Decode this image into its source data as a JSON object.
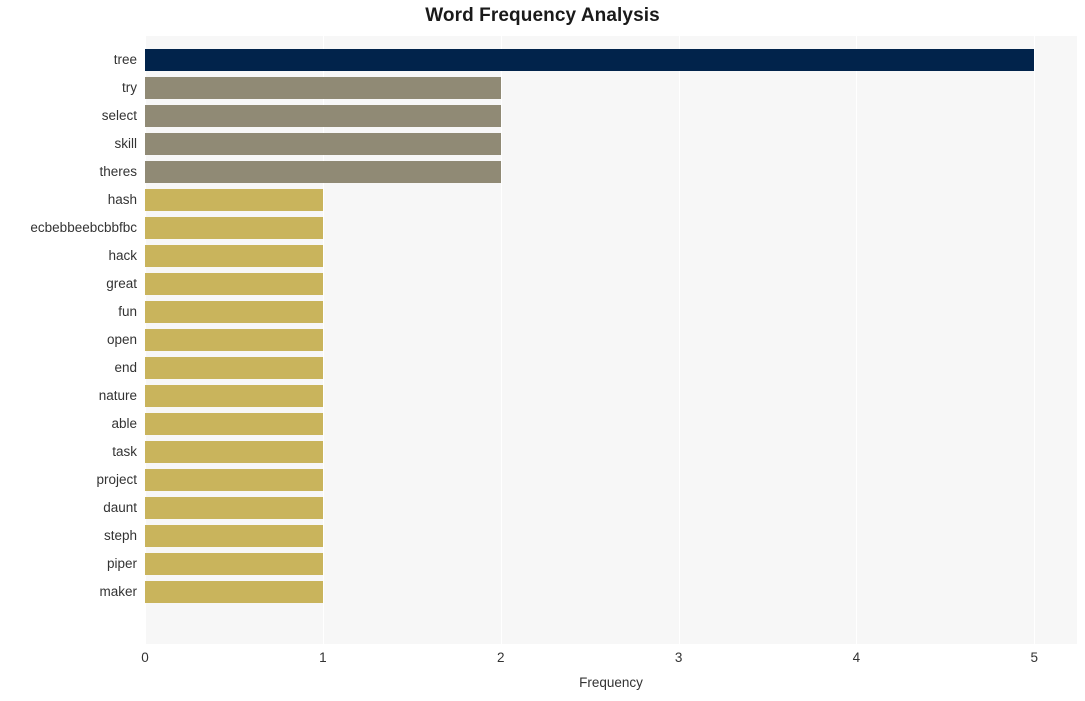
{
  "chart_data": {
    "type": "bar",
    "orientation": "horizontal",
    "title": "Word Frequency Analysis",
    "xlabel": "Frequency",
    "ylabel": "",
    "xlim": [
      0,
      5.24
    ],
    "xticks": [
      0,
      1,
      2,
      3,
      4,
      5
    ],
    "xtick_labels": [
      "0",
      "1",
      "2",
      "3",
      "4",
      "5"
    ],
    "grid": true,
    "grid_axis": "x",
    "legend": null,
    "categories": [
      "tree",
      "try",
      "select",
      "skill",
      "theres",
      "hash",
      "ecbebbeebcbbfbc",
      "hack",
      "great",
      "fun",
      "open",
      "end",
      "nature",
      "able",
      "task",
      "project",
      "daunt",
      "steph",
      "piper",
      "maker"
    ],
    "values": [
      5,
      2,
      2,
      2,
      2,
      1,
      1,
      1,
      1,
      1,
      1,
      1,
      1,
      1,
      1,
      1,
      1,
      1,
      1,
      1
    ],
    "bar_colors": [
      "#01234b",
      "#908a75",
      "#908a75",
      "#908a75",
      "#908a75",
      "#c9b45c",
      "#c9b45c",
      "#c9b45c",
      "#c9b45c",
      "#c9b45c",
      "#c9b45c",
      "#c9b45c",
      "#c9b45c",
      "#c9b45c",
      "#c9b45c",
      "#c9b45c",
      "#c9b45c",
      "#c9b45c",
      "#c9b45c",
      "#c9b45c"
    ]
  },
  "colors": {
    "figure_background": "#ffffff",
    "plot_background": "#f7f7f7",
    "gridline": "#ffffff",
    "title_text": "#1a1a1a",
    "tick_text": "#333333",
    "accent_primary": "#01234b",
    "accent_secondary": "#908a75",
    "accent_tertiary": "#c9b45c"
  }
}
